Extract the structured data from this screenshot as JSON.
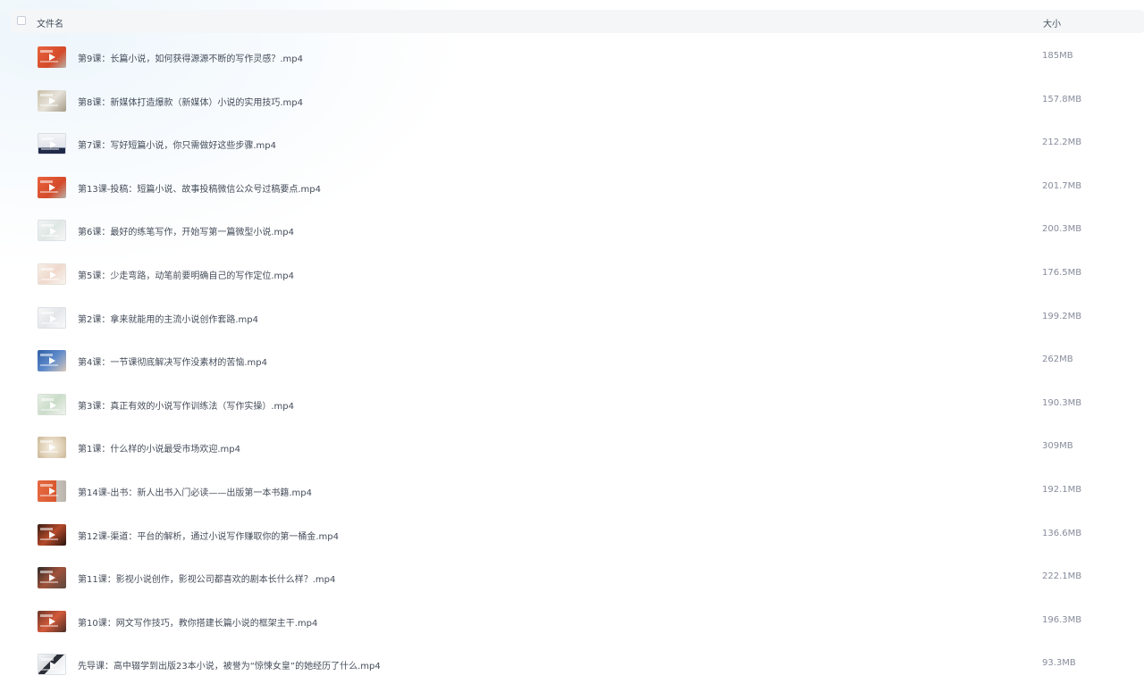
{
  "header": {
    "col_name": "文件名",
    "col_size": "大小"
  },
  "files": [
    {
      "name": "第9课：长篇小说，如何获得源源不断的写作灵感？.mp4",
      "size": "185MB",
      "thumb": "orange"
    },
    {
      "name": "第8课：新媒体打造爆款（新媒体）小说的实用技巧.mp4",
      "size": "157.8MB",
      "thumb": "beige"
    },
    {
      "name": "第7课：写好短篇小说，你只需做好这些步骤.mp4",
      "size": "212.2MB",
      "thumb": "navy"
    },
    {
      "name": "第13课-投稿：短篇小说、故事投稿微信公众号过稿要点.mp4",
      "size": "201.7MB",
      "thumb": "orange"
    },
    {
      "name": "第6课：最好的练笔写作，开始写第一篇微型小说.mp4",
      "size": "200.3MB",
      "thumb": "light"
    },
    {
      "name": "第5课：少走弯路，动笔前要明确自己的写作定位.mp4",
      "size": "176.5MB",
      "thumb": "cream"
    },
    {
      "name": "第2课：拿来就能用的主流小说创作套路.mp4",
      "size": "199.2MB",
      "thumb": "white"
    },
    {
      "name": "第4课：一节课彻底解决写作没素材的苦恼.mp4",
      "size": "262MB",
      "thumb": "blue"
    },
    {
      "name": "第3课：真正有效的小说写作训练法（写作实操）.mp4",
      "size": "190.3MB",
      "thumb": "green"
    },
    {
      "name": "第1课：什么样的小说最受市场欢迎.mp4",
      "size": "309MB",
      "thumb": "tan"
    },
    {
      "name": "第14课-出书：新人出书入门必读——出版第一本书籍.mp4",
      "size": "192.1MB",
      "thumb": "orange2"
    },
    {
      "name": "第12课-渠道：平台的解析，通过小说写作赚取你的第一桶金.mp4",
      "size": "136.6MB",
      "thumb": "dark"
    },
    {
      "name": "第11课：影视小说创作，影视公司都喜欢的剧本长什么样？.mp4",
      "size": "222.1MB",
      "thumb": "dark2"
    },
    {
      "name": "第10课：网文写作技巧，教你搭建长篇小说的框架主干.mp4",
      "size": "196.3MB",
      "thumb": "dark3"
    },
    {
      "name": "先导课：高中辍学到出版23本小说，被誉为“惊悚女皇”的她经历了什么.mp4",
      "size": "93.3MB",
      "thumb": "doc"
    }
  ]
}
